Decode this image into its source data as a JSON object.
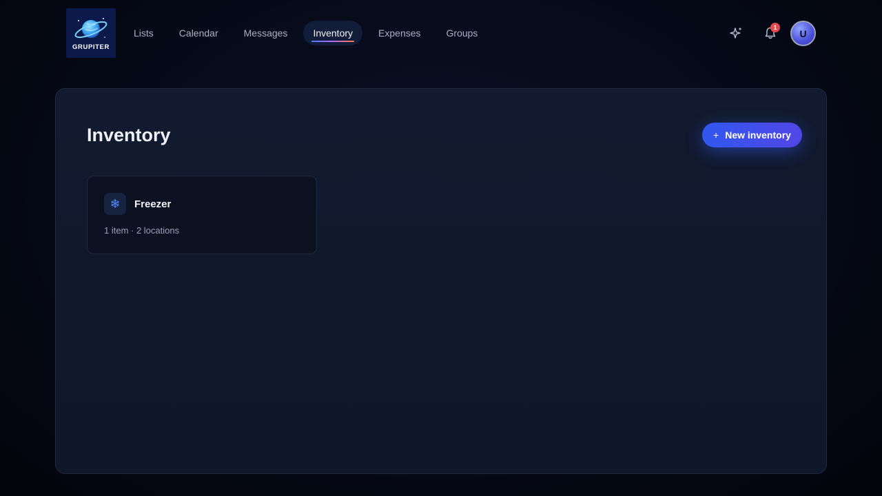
{
  "brand": {
    "name": "GRUPITER"
  },
  "nav": {
    "items": [
      {
        "label": "Lists"
      },
      {
        "label": "Calendar"
      },
      {
        "label": "Messages"
      },
      {
        "label": "Inventory",
        "active": true
      },
      {
        "label": "Expenses"
      },
      {
        "label": "Groups"
      }
    ]
  },
  "header": {
    "sparkle_icon": "sparkle-icon",
    "bell_icon": "bell-icon",
    "notification_count": "1",
    "avatar_initial": "U"
  },
  "main": {
    "title": "Inventory",
    "new_button_plus": "+",
    "new_button_label": "New inventory",
    "inventories": [
      {
        "icon": "snowflake-icon",
        "icon_glyph": "❄",
        "name": "Freezer",
        "meta": "1 item · 2 locations"
      }
    ]
  },
  "colors": {
    "accent": "#3157f0",
    "badge": "#e5484d",
    "background": "#0f172a"
  }
}
